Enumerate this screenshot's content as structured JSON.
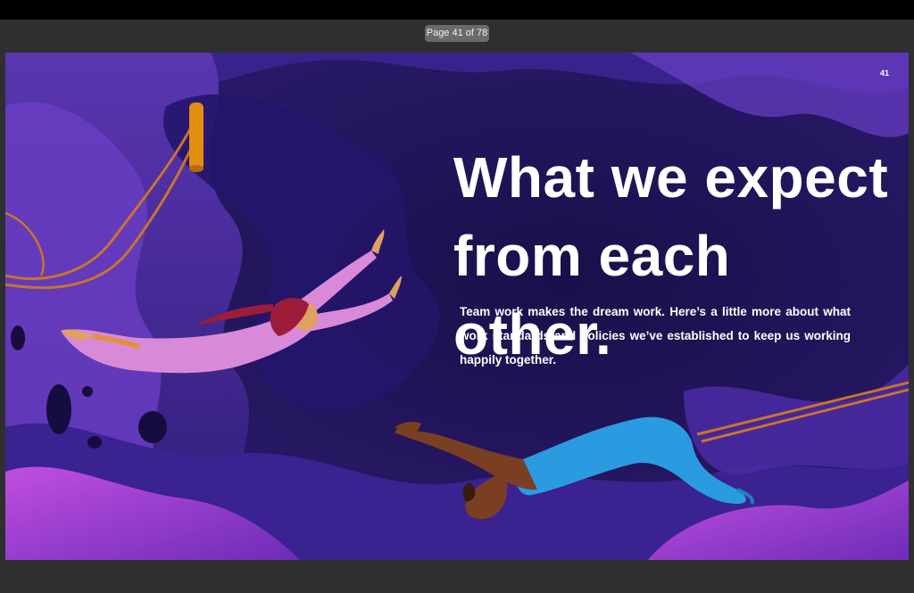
{
  "viewer": {
    "page_indicator": "Page 41 of 78"
  },
  "page": {
    "number": "41",
    "headline_line1": "What we expect",
    "headline_line2": "from each other.",
    "body": "Team work makes the dream work.  Here’s a little more about what work standards and policies we’ve established to keep us working happily together."
  },
  "colors": {
    "background_deep": "#1c1450",
    "wave_purple": "#4a2a9a",
    "wave_magenta": "#a23fd0",
    "rope_orange": "#c8742c",
    "trapeze_bar": "#e0900e",
    "acrobat1_outfit": "#d88ad8",
    "acrobat1_hair": "#9c1c3a",
    "acrobat2_outfit": "#2a9be0",
    "skin_light": "#e0a060",
    "skin_dark": "#7a3f22"
  },
  "illustration": {
    "icons": [
      "trapeze-bar-icon",
      "acrobat-woman-icon",
      "acrobat-man-icon",
      "rope-icon"
    ]
  }
}
